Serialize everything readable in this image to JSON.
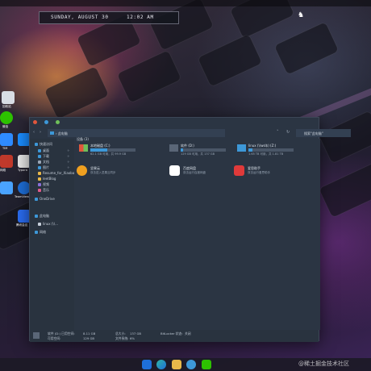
{
  "topbar": {
    "date": "SUNDAY, AUGUST 30",
    "time": "12:02 AM"
  },
  "desktop": {
    "icons": [
      {
        "label": "回收站",
        "color": "#ffffff"
      },
      {
        "label": "微信",
        "color": "#2dc100"
      },
      {
        "label": "TIM",
        "color": "#2f8bff"
      },
      {
        "label": "Typora",
        "color": "#e8e8e8"
      },
      {
        "label": "网络",
        "color": "#4aa3ff"
      },
      {
        "label": "TeamViewer",
        "color": "#1e6fd9"
      },
      {
        "label": "腾讯会议",
        "color": "#2a6cf0"
      }
    ]
  },
  "window": {
    "breadcrumb": "此电脑",
    "search_placeholder": "搜索\"此电脑\"",
    "sidebar": {
      "quick_access": "快速访问",
      "items": [
        {
          "label": "桌面",
          "pinned": true
        },
        {
          "label": "下载",
          "pinned": true
        },
        {
          "label": "文档",
          "pinned": true
        },
        {
          "label": "图片",
          "pinned": true
        },
        {
          "label": "Resume_for_Xiaobai",
          "pinned": false
        },
        {
          "label": "leetBlog",
          "pinned": false
        },
        {
          "label": "视频",
          "pinned": false
        },
        {
          "label": "音乐",
          "pinned": false
        }
      ],
      "onedrive": "OneDrive",
      "this_pc": "此电脑",
      "linux": "linux (\\\\...",
      "network": "网络"
    },
    "group_devices": "设备 (3)",
    "drives": [
      {
        "name": "本地磁盘 (C:)",
        "free": "62.1 GB 可用，共 99.9 GB",
        "used_fraction": 0.38
      },
      {
        "name": "软件 (D:)",
        "free": "129 GB 可用，共 137 GB",
        "used_fraction": 0.06
      },
      {
        "name": "linux (\\\\wsl$) (Z:)",
        "free": "1.65 TB 可用，共 1.81 TB",
        "used_fraction": 0.09
      }
    ],
    "apps": [
      {
        "name": "坚果云",
        "desc": "双击进入坚果云同步",
        "color": "#f0a020"
      },
      {
        "name": "百度网盘",
        "desc": "双击运行百度网盘",
        "color": "#ffffff"
      },
      {
        "name": "爱思助手",
        "desc": "双击运行爱思助手",
        "color": "#e03a3a"
      }
    ],
    "status": {
      "selected": "软件 (D:) 已用空间:",
      "used": "8.11 GB",
      "free_label": "可用空间:",
      "free": "129 GB",
      "total_label": "总大小:",
      "total": "137 GB",
      "fs_label": "文件系统:",
      "fs": "NTFS",
      "percent_label": "已用百分比:",
      "percent": "6%",
      "bitlocker_label": "BitLocker 状态:",
      "bitlocker": "关闭",
      "available_label": "可用空间:"
    }
  },
  "taskbar": {
    "watermark": "@稀土掘金技术社区"
  }
}
